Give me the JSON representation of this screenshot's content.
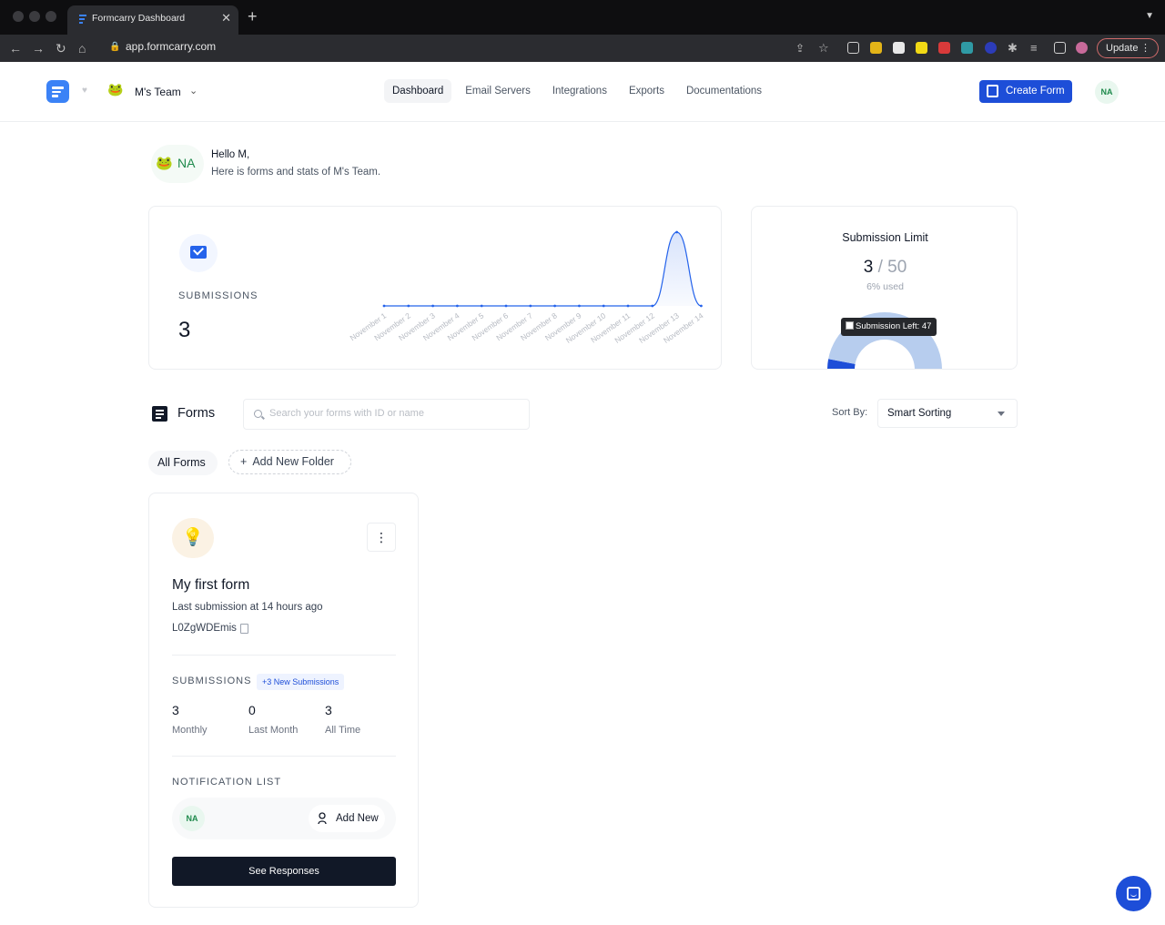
{
  "browser": {
    "tab_title": "Formcarry Dashboard",
    "url": "app.formcarry.com",
    "update_label": "Update"
  },
  "header": {
    "team_name": "M's Team",
    "nav": [
      "Dashboard",
      "Email Servers",
      "Integrations",
      "Exports",
      "Documentations"
    ],
    "active_nav": "Dashboard",
    "create_label": "Create Form",
    "user_initials": "NA"
  },
  "greeting": {
    "initials": "NA",
    "hello": "Hello M,",
    "subtitle": "Here is forms and stats of M's Team."
  },
  "submissions": {
    "label": "SUBMISSIONS",
    "value": "3"
  },
  "chart_data": {
    "type": "area",
    "categories": [
      "November 1",
      "November 2",
      "November 3",
      "November 4",
      "November 5",
      "November 6",
      "November 7",
      "November 8",
      "November 9",
      "November 10",
      "November 11",
      "November 12",
      "November 13",
      "November 14"
    ],
    "values": [
      0,
      0,
      0,
      0,
      0,
      0,
      0,
      0,
      0,
      0,
      0,
      0,
      3,
      0
    ],
    "title": "",
    "xlabel": "",
    "ylabel": "",
    "ylim": [
      0,
      3
    ],
    "grid": false,
    "color": "#2563eb"
  },
  "limit": {
    "title": "Submission Limit",
    "used": "3",
    "total": "/ 50",
    "percent_text": "6% used",
    "tooltip": "Submission Left: 47",
    "used_value": 3,
    "total_value": 50,
    "used_color": "#1d4ed8",
    "left_color": "#b7cdee"
  },
  "forms": {
    "title": "Forms",
    "search_placeholder": "Search your forms with ID or name",
    "sort_label": "Sort By:",
    "sort_value": "Smart Sorting",
    "folders": {
      "all": "All Forms",
      "add": "Add New Folder"
    }
  },
  "form_card": {
    "name": "My first form",
    "last_submission": "Last submission at 14 hours ago",
    "id": "L0ZgWDEmis",
    "submissions_label": "SUBMISSIONS",
    "new_badge": "+3 New Submissions",
    "stats": [
      {
        "value": "3",
        "label": "Monthly"
      },
      {
        "value": "0",
        "label": "Last Month"
      },
      {
        "value": "3",
        "label": "All Time"
      }
    ],
    "notification_label": "NOTIFICATION LIST",
    "notif_initials": "NA",
    "add_new_label": "Add New",
    "see_responses_label": "See Responses"
  },
  "colors": {
    "brand": "#1d4ed8",
    "dark_button": "#111827"
  }
}
